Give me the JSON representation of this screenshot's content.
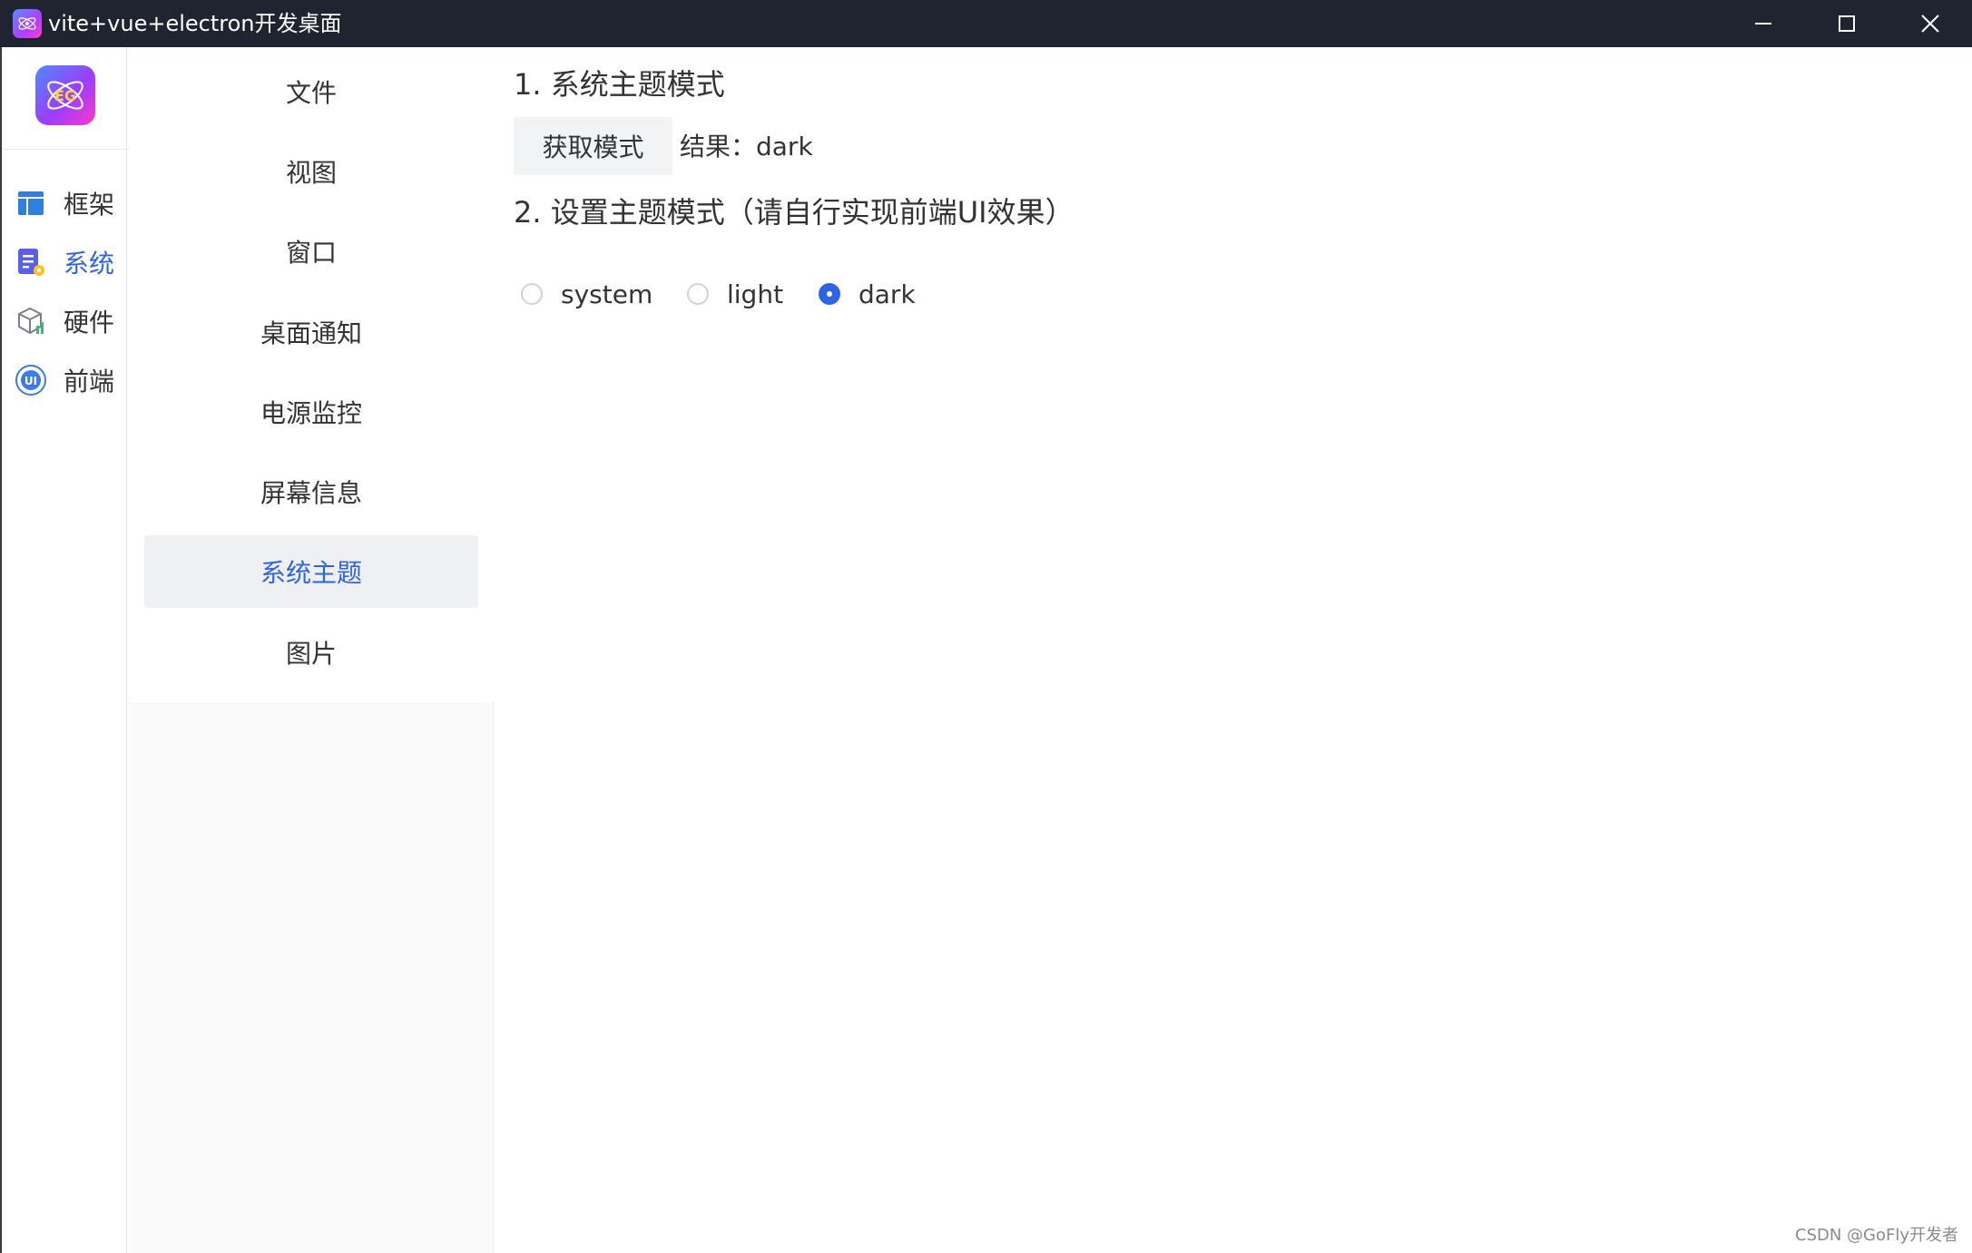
{
  "window": {
    "title": "vite+vue+electron开发桌面",
    "minimize_icon": "minimize-icon",
    "maximize_icon": "maximize-icon",
    "close_icon": "close-icon"
  },
  "rail": {
    "logo_text": "EG",
    "items": [
      {
        "label": "框架",
        "icon": "layout-icon"
      },
      {
        "label": "系统",
        "icon": "system-doc-icon",
        "active": true
      },
      {
        "label": "硬件",
        "icon": "hardware-box-icon"
      },
      {
        "label": "前端",
        "icon": "ui-badge-icon"
      }
    ]
  },
  "submenu": {
    "items": [
      {
        "label": "文件"
      },
      {
        "label": "视图"
      },
      {
        "label": "窗口"
      },
      {
        "label": "桌面通知"
      },
      {
        "label": "电源监控"
      },
      {
        "label": "屏幕信息"
      },
      {
        "label": "系统主题",
        "active": true
      },
      {
        "label": "图片"
      }
    ]
  },
  "main": {
    "section1_title": "1. 系统主题模式",
    "get_mode_button": "获取模式",
    "result_text": "结果：dark",
    "section2_title": "2. 设置主题模式（请自行实现前端UI效果）",
    "radios": [
      {
        "label": "system",
        "checked": false
      },
      {
        "label": "light",
        "checked": false
      },
      {
        "label": "dark",
        "checked": true
      }
    ]
  },
  "watermark": "CSDN @GoFly开发者",
  "colors": {
    "accent": "#2f63e6",
    "titlebar": "#1f2430"
  }
}
